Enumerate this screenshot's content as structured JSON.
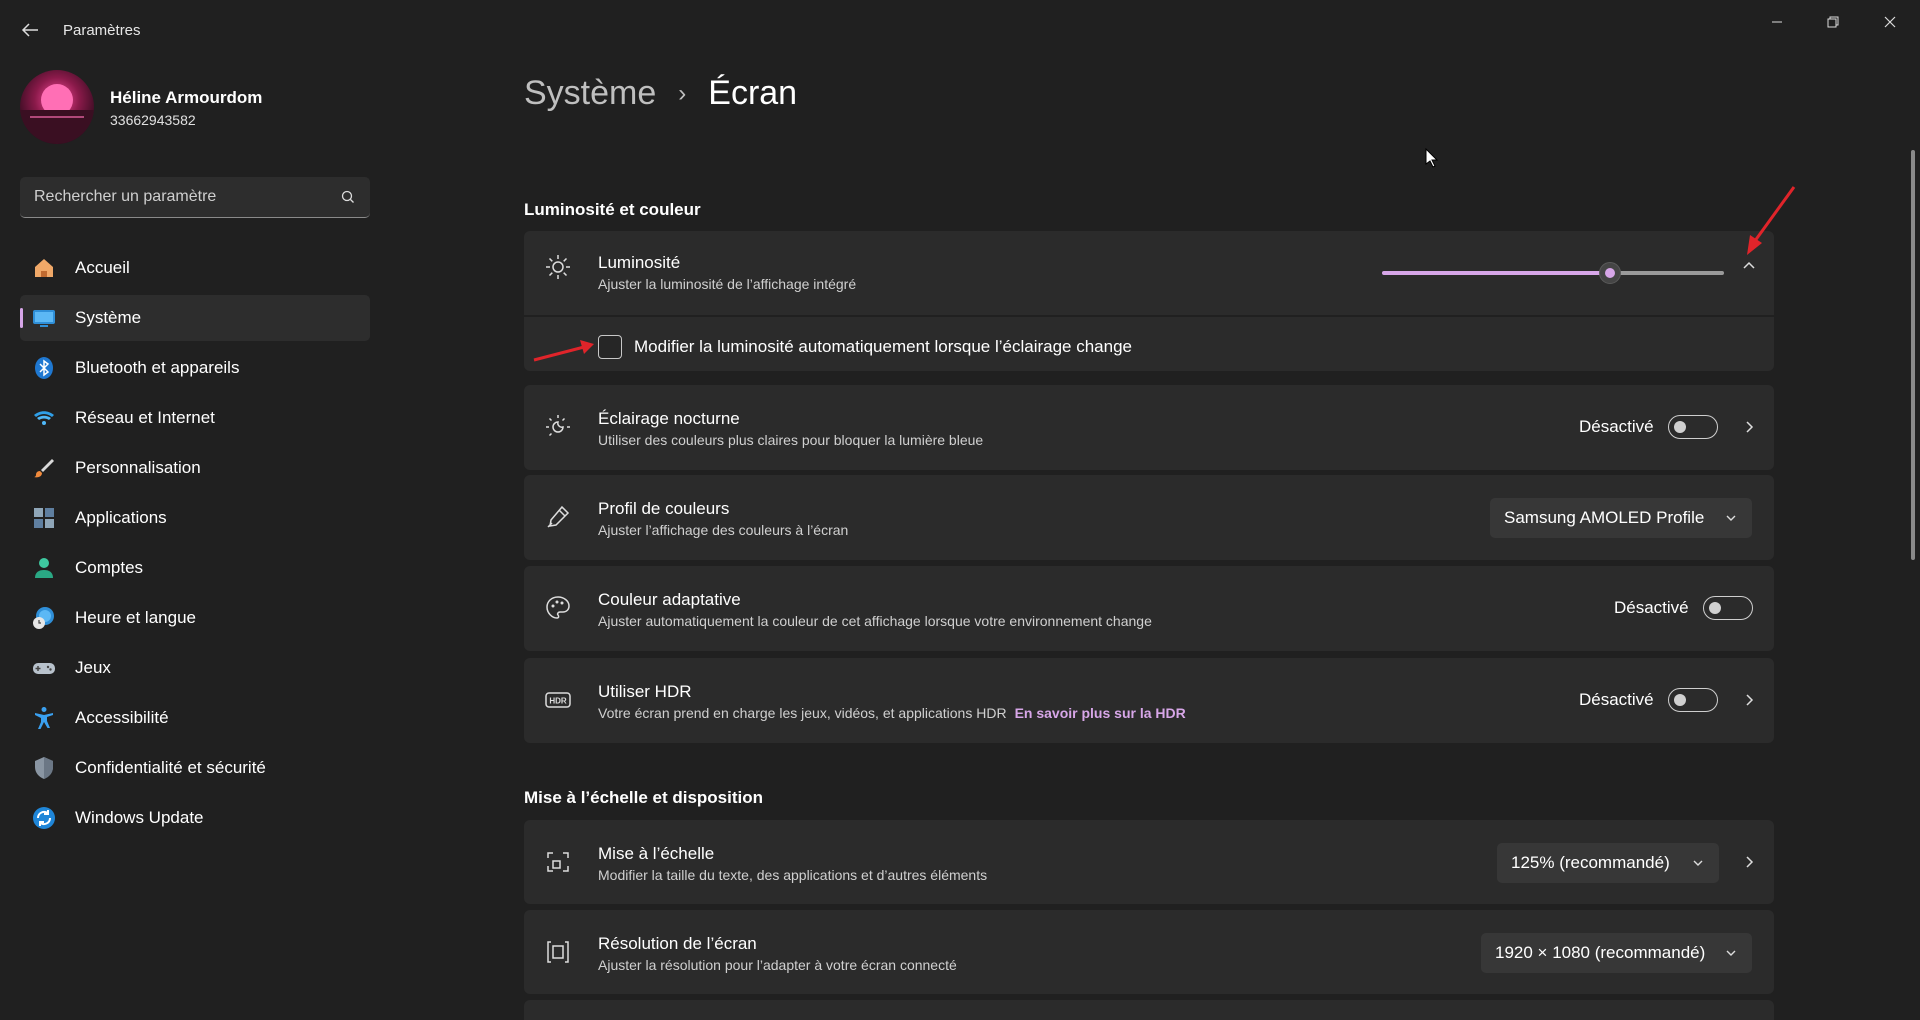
{
  "app": {
    "title": "Paramètres"
  },
  "profile": {
    "name": "Héline Armourdom",
    "sub": "33662943582"
  },
  "search": {
    "placeholder": "Rechercher un paramètre"
  },
  "nav": {
    "items": [
      {
        "label": "Accueil",
        "icon": "home-icon"
      },
      {
        "label": "Système",
        "icon": "system-icon",
        "active": true
      },
      {
        "label": "Bluetooth et appareils",
        "icon": "bluetooth-icon"
      },
      {
        "label": "Réseau et Internet",
        "icon": "wifi-icon"
      },
      {
        "label": "Personnalisation",
        "icon": "brush-icon"
      },
      {
        "label": "Applications",
        "icon": "apps-icon"
      },
      {
        "label": "Comptes",
        "icon": "account-icon"
      },
      {
        "label": "Heure et langue",
        "icon": "globe-clock-icon"
      },
      {
        "label": "Jeux",
        "icon": "gamepad-icon"
      },
      {
        "label": "Accessibilité",
        "icon": "accessibility-icon"
      },
      {
        "label": "Confidentialité et sécurité",
        "icon": "shield-icon"
      },
      {
        "label": "Windows Update",
        "icon": "update-icon"
      }
    ]
  },
  "breadcrumb": {
    "parent": "Système",
    "current": "Écran"
  },
  "sections": {
    "brightness_color": "Luminosité et couleur",
    "scale_layout": "Mise à l’échelle et disposition"
  },
  "brightness": {
    "title": "Luminosité",
    "desc": "Ajuster la luminosité de l’affichage intégré",
    "level": 0.69,
    "auto_label": "Modifier la luminosité automatiquement lorsque l’éclairage change",
    "auto_checked": false
  },
  "night_light": {
    "title": "Éclairage nocturne",
    "desc": "Utiliser des couleurs plus claires pour bloquer la lumière bleue",
    "state": "Désactivé"
  },
  "color_profile": {
    "title": "Profil de couleurs",
    "desc": "Ajuster l’affichage des couleurs à l’écran",
    "value": "Samsung AMOLED Profile"
  },
  "adaptive_color": {
    "title": "Couleur adaptative",
    "desc": "Ajuster automatiquement la couleur de cet affichage lorsque votre environnement change",
    "state": "Désactivé"
  },
  "hdr": {
    "title": "Utiliser HDR",
    "desc": "Votre écran prend en charge les jeux, vidéos, et applications HDR",
    "link": "En savoir plus sur la HDR",
    "state": "Désactivé",
    "badge": "HDR"
  },
  "scale": {
    "title": "Mise à l’échelle",
    "desc": "Modifier la taille du texte, des applications et d’autres éléments",
    "value": "125% (recommandé)"
  },
  "resolution": {
    "title": "Résolution de l’écran",
    "desc": "Ajuster la résolution pour l’adapter à  votre  écran connecté",
    "value": "1920 × 1080 (recommandé)"
  },
  "colors": {
    "accent": "#d7a6e8",
    "background": "#202020",
    "card": "#2b2b2b",
    "annotation": "#e0242a"
  }
}
